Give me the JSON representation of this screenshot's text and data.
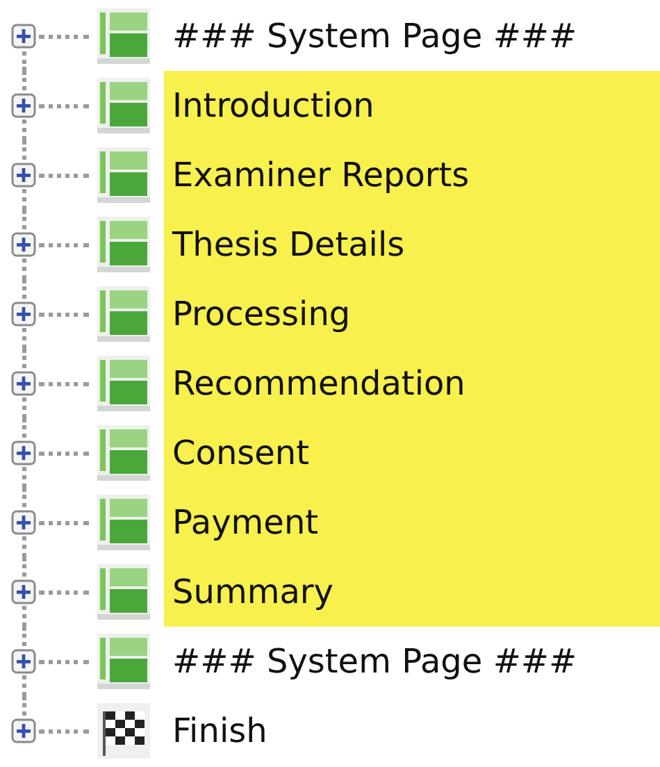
{
  "tree": [
    {
      "label": "### System Page ###",
      "kind": "page",
      "highlighted": false,
      "expanded": false
    },
    {
      "label": "Introduction",
      "kind": "page",
      "highlighted": true,
      "expanded": false
    },
    {
      "label": "Examiner Reports",
      "kind": "page",
      "highlighted": true,
      "expanded": false
    },
    {
      "label": "Thesis Details",
      "kind": "page",
      "highlighted": true,
      "expanded": false
    },
    {
      "label": "Processing",
      "kind": "page",
      "highlighted": true,
      "expanded": false
    },
    {
      "label": "Recommendation",
      "kind": "page",
      "highlighted": true,
      "expanded": false
    },
    {
      "label": "Consent",
      "kind": "page",
      "highlighted": true,
      "expanded": false
    },
    {
      "label": "Payment",
      "kind": "page",
      "highlighted": true,
      "expanded": false
    },
    {
      "label": "Summary",
      "kind": "page",
      "highlighted": true,
      "expanded": false
    },
    {
      "label": "### System Page ###",
      "kind": "page",
      "highlighted": false,
      "expanded": false
    },
    {
      "label": "Finish",
      "kind": "finish",
      "highlighted": false,
      "expanded": false
    }
  ]
}
